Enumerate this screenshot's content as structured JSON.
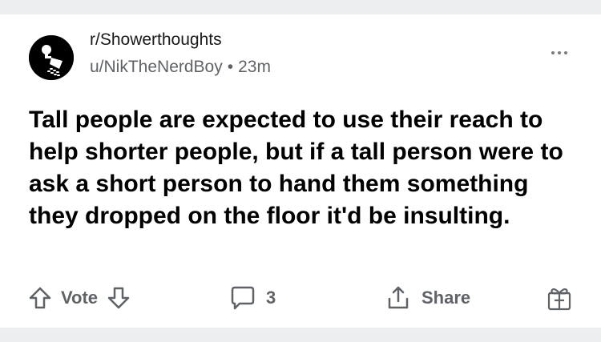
{
  "post": {
    "subreddit": "r/Showerthoughts",
    "author": "u/NikTheNerdBoy",
    "separator": "•",
    "time": "23m",
    "title": "Tall people are expected to use their reach to help shorter people, but if a tall person were to ask a short person to hand them something they dropped on the floor it'd be insulting."
  },
  "actions": {
    "vote_label": "Vote",
    "comment_count": "3",
    "share_label": "Share"
  },
  "icons": {
    "subreddit": "showerhead-lightbulb-icon",
    "more": "more-options-icon",
    "upvote": "upvote-arrow-icon",
    "downvote": "downvote-arrow-icon",
    "comment": "comment-bubble-icon",
    "share": "share-icon",
    "award": "gift-award-icon"
  },
  "colors": {
    "background": "#edeef0",
    "card": "#ffffff",
    "text": "#000000",
    "muted": "#5f6368"
  }
}
